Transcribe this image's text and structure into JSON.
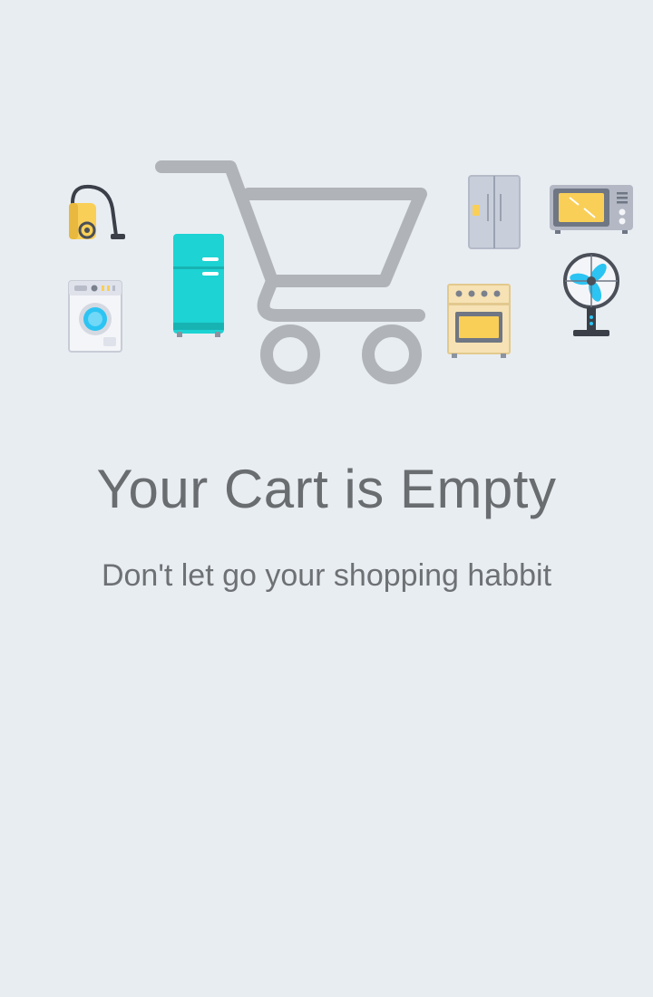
{
  "empty_state": {
    "title": "Your Cart is Empty",
    "subtitle": "Don't let go your shopping habbit"
  },
  "illustration": {
    "icons": [
      "shopping-cart-icon",
      "vacuum-cleaner-icon",
      "washing-machine-icon",
      "fridge-icon",
      "double-door-fridge-icon",
      "microwave-icon",
      "oven-stove-icon",
      "table-fan-icon"
    ]
  },
  "colors": {
    "background": "#e8edf2",
    "text": "#6a6d70",
    "cart": "#b0b4b8",
    "fridge_teal": "#1dd3d3",
    "accent_yellow": "#f9cf57",
    "accent_blue": "#2cc4f2"
  }
}
